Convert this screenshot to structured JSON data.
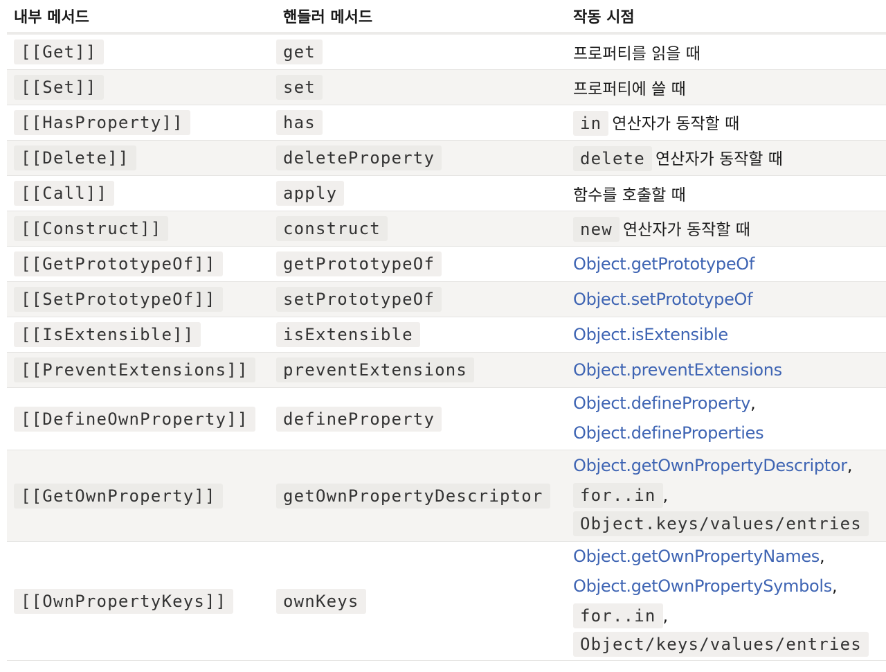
{
  "header": {
    "col1": "내부 메서드",
    "col2": "핸들러 메서드",
    "col3": "작동 시점"
  },
  "rows": [
    {
      "internal": "[[Get]]",
      "handler": "get",
      "when_text": "프로퍼티를 읽을 때"
    },
    {
      "internal": "[[Set]]",
      "handler": "set",
      "when_text": "프로퍼티에 쓸 때"
    },
    {
      "internal": "[[HasProperty]]",
      "handler": "has",
      "when_code": "in",
      "when_text": "연산자가 동작할 때"
    },
    {
      "internal": "[[Delete]]",
      "handler": "deleteProperty",
      "when_code": "delete",
      "when_text": "연산자가 동작할 때"
    },
    {
      "internal": "[[Call]]",
      "handler": "apply",
      "when_text": "함수를 호출할 때"
    },
    {
      "internal": "[[Construct]]",
      "handler": "construct",
      "when_code": "new",
      "when_text": "연산자가 동작할 때"
    },
    {
      "internal": "[[GetPrototypeOf]]",
      "handler": "getPrototypeOf",
      "when_link": "Object.getPrototypeOf"
    },
    {
      "internal": "[[SetPrototypeOf]]",
      "handler": "setPrototypeOf",
      "when_link": "Object.setPrototypeOf"
    },
    {
      "internal": "[[IsExtensible]]",
      "handler": "isExtensible",
      "when_link": "Object.isExtensible"
    },
    {
      "internal": "[[PreventExtensions]]",
      "handler": "preventExtensions",
      "when_link": "Object.preventExtensions"
    },
    {
      "internal": "[[DefineOwnProperty]]",
      "handler": "defineProperty",
      "when_link_1": "Object.defineProperty",
      "when_link_2": "Object.defineProperties"
    },
    {
      "internal": "[[GetOwnProperty]]",
      "handler": "getOwnPropertyDescriptor",
      "when_link_1": "Object.getOwnPropertyDescriptor",
      "when_code_1": "for..in",
      "when_code_2": "Object.keys/values/entries"
    },
    {
      "internal": "[[OwnPropertyKeys]]",
      "handler": "ownKeys",
      "when_link_1": "Object.getOwnPropertyNames",
      "when_link_2": "Object.getOwnPropertySymbols",
      "when_code_1": "for..in",
      "when_code_2": "Object/keys/values/entries"
    }
  ],
  "punct": {
    "comma": ","
  },
  "colors": {
    "link": "#3e64b3",
    "row_alt": "#f5f4f2",
    "code_bg": "#f1efed"
  }
}
